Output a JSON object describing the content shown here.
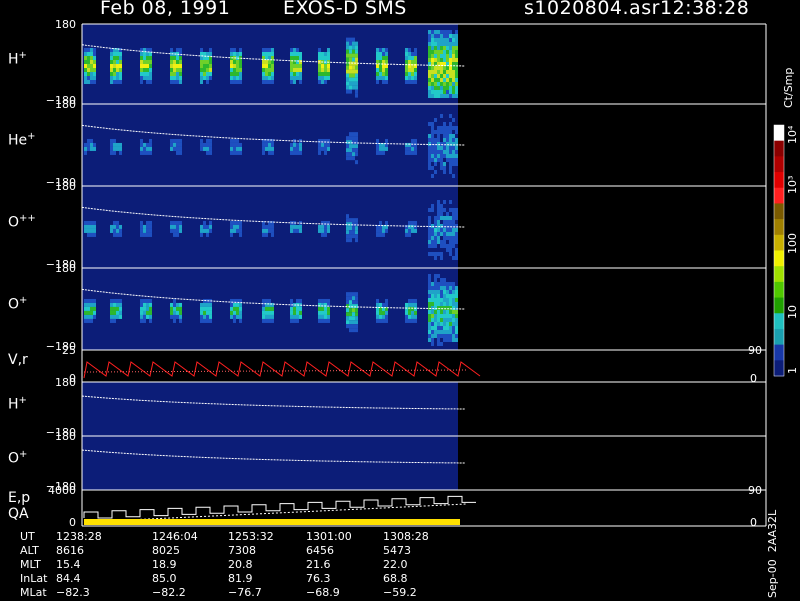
{
  "header": {
    "date": "Feb 08, 1991",
    "instrument": "EXOS-D SMS",
    "file": "s1020804.asr",
    "time": "12:38:28"
  },
  "colorbar": {
    "title": "Ct/Smp",
    "ticks": [
      "10⁴",
      "10³",
      "100",
      "10",
      "1"
    ]
  },
  "side_label": "Sep-00  2AA32L",
  "chart_data": [
    {
      "type": "heatmap",
      "panel": "H+",
      "label": "H",
      "sup": "+",
      "ylim": [
        -180,
        180
      ],
      "ticks": [
        "180",
        "−180"
      ]
    },
    {
      "type": "heatmap",
      "panel": "He+",
      "label": "He",
      "sup": "+",
      "ylim": [
        -180,
        180
      ],
      "ticks": [
        "180",
        "−180"
      ]
    },
    {
      "type": "heatmap",
      "panel": "O++",
      "label": "O",
      "sup": "++",
      "ylim": [
        -180,
        180
      ],
      "ticks": [
        "180",
        "−180"
      ]
    },
    {
      "type": "heatmap",
      "panel": "O+",
      "label": "O",
      "sup": "+",
      "ylim": [
        -180,
        180
      ],
      "ticks": [
        "180",
        "−180"
      ]
    },
    {
      "type": "line",
      "panel": "V,r",
      "label": "V,r",
      "sup": "",
      "ylim": [
        0,
        25
      ],
      "ticks": [
        "25",
        "0"
      ],
      "right_ticks": [
        "90",
        "0"
      ]
    },
    {
      "type": "heatmap",
      "panel": "H+ (2)",
      "label": "H",
      "sup": "+",
      "ylim": [
        -180,
        180
      ],
      "ticks": [
        "180",
        "−180"
      ]
    },
    {
      "type": "heatmap",
      "panel": "O+ (2)",
      "label": "O",
      "sup": "+",
      "ylim": [
        -180,
        180
      ],
      "ticks": [
        "180",
        "−180"
      ]
    },
    {
      "type": "line",
      "panel": "E,p QA",
      "label": "E,p",
      "label2": "QA",
      "sup": "",
      "ylim": [
        0,
        4000
      ],
      "ticks": [
        "4000",
        "0"
      ],
      "right_ticks": [
        "90",
        "0"
      ]
    }
  ],
  "footer": {
    "rows": [
      {
        "name": "UT",
        "values": [
          "1238:28",
          "1246:04",
          "1253:32",
          "1301:00",
          "1308:28"
        ]
      },
      {
        "name": "ALT",
        "values": [
          "8616",
          "8025",
          "7308",
          "6456",
          "5473"
        ]
      },
      {
        "name": "MLT",
        "values": [
          "15.4",
          "18.9",
          "20.8",
          "21.6",
          "22.0"
        ]
      },
      {
        "name": "InLat",
        "values": [
          "84.4",
          "85.0",
          "81.9",
          "76.3",
          "68.8"
        ]
      },
      {
        "name": "MLat",
        "values": [
          "−82.3",
          "−82.2",
          "−76.7",
          "−68.9",
          "−59.2"
        ]
      }
    ]
  }
}
